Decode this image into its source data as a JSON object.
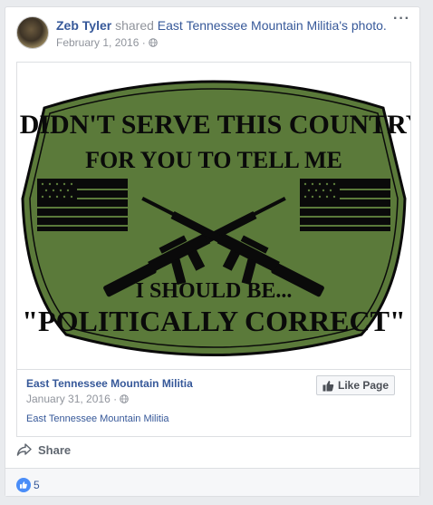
{
  "post": {
    "author": "Zeb Tyler",
    "shared_text": " shared ",
    "page_name": "East Tennessee Mountain Militia",
    "suffix": "'s photo.",
    "date": "February 1, 2016",
    "separator": "·",
    "more_label": "···"
  },
  "image": {
    "line1": "I DIDN'T SERVE THIS COUNTRY",
    "line2": "FOR YOU TO TELL ME",
    "line3": "I SHOULD BE...",
    "line4": "\"POLITICALLY CORRECT\"",
    "badge_color": "#5b7a3a",
    "text_color": "#0a0a0a"
  },
  "source": {
    "name": "East Tennessee Mountain Militia",
    "date": "January 31, 2016",
    "separator": "·",
    "description": "East Tennessee Mountain Militia",
    "like_page_label": "Like Page"
  },
  "actions": {
    "share_label": "Share"
  },
  "reactions": {
    "count": "5",
    "icon": "like-icon"
  },
  "colors": {
    "link": "#365899",
    "meta": "#90949c",
    "like_blue": "#4a8df8"
  }
}
